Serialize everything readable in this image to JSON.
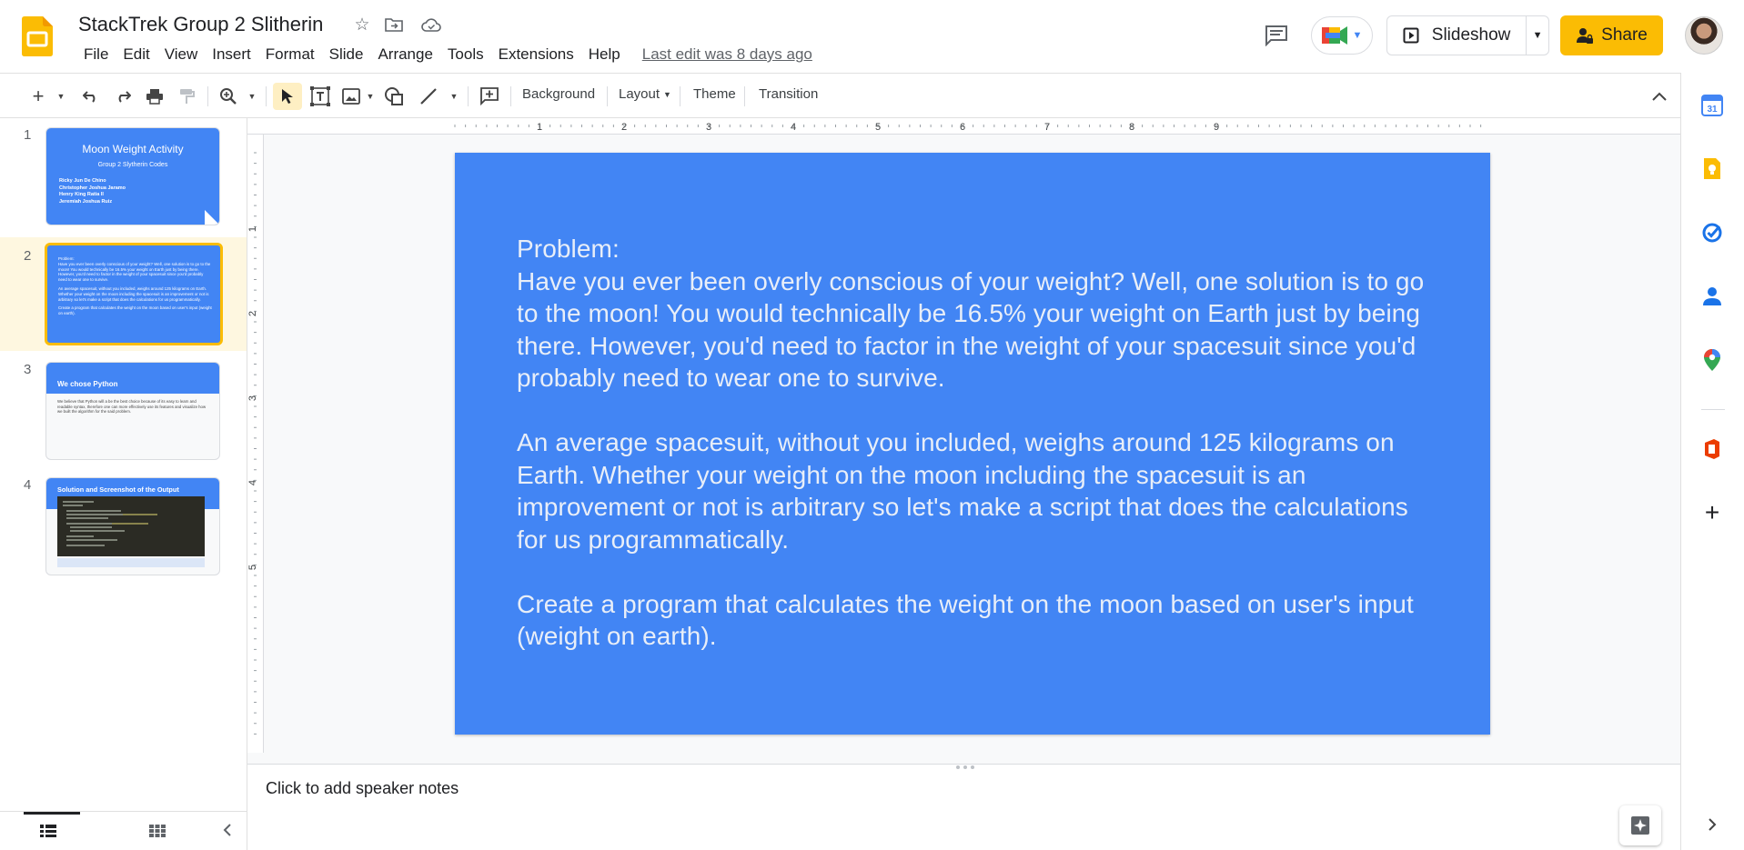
{
  "app": {
    "title": "StackTrek Group 2 Slitherin",
    "brand_color": "#fbbc04"
  },
  "menu": {
    "items": [
      "File",
      "Edit",
      "View",
      "Insert",
      "Format",
      "Slide",
      "Arrange",
      "Tools",
      "Extensions",
      "Help"
    ],
    "last_edit": "Last edit was 8 days ago"
  },
  "header": {
    "slideshow_label": "Slideshow",
    "share_label": "Share"
  },
  "toolbar": {
    "background_label": "Background",
    "layout_label": "Layout",
    "theme_label": "Theme",
    "transition_label": "Transition"
  },
  "filmstrip": {
    "selected": 2,
    "slides": [
      {
        "number": "1",
        "title": "Moon Weight Activity",
        "subtitle": "Group 2 Slytherin Codes",
        "names": [
          "Ricky Jun De Chino",
          "Christopher Joshua Jaramo",
          "Henry King Ratia II",
          "Jeremiah Joshua Ruiz"
        ]
      },
      {
        "number": "2",
        "lines": [
          "Problem:",
          "Have you ever been overly conscious of your weight? Well, one solution is to go to the moon! You would technically be 16.5% your weight on Earth just by being there. However, you'd need to factor in the weight of your spacesuit since you'd probably need to wear one to survive.",
          "An average spacesuit, without you included, weighs around 125 kilograms on Earth. Whether your weight on the moon including the spacesuit is an improvement or not is arbitrary so let's make a script that does the calculations for us programmatically.",
          "Create a program that calculates the weight on the moon based on user's input (weight on earth)."
        ]
      },
      {
        "number": "3",
        "title": "We chose Python",
        "body": "We believe that Python will a be the best choice because of its easy to learn and readable syntax, therefore one can more effectively use its features and visualize how we built the algorithm for the said problem."
      },
      {
        "number": "4",
        "title": "Solution and Screenshot of the Output"
      }
    ]
  },
  "slide": {
    "background": "#4285f4",
    "paragraphs": [
      "Problem:\nHave you ever been overly conscious of your weight? Well, one solution is to go to the moon! You would technically be 16.5% your weight on Earth just by being there. However, you'd need to factor in the weight of your spacesuit since you'd probably need to wear one to survive.",
      "An average spacesuit, without you included, weighs around 125 kilograms on Earth. Whether your weight on the moon including the spacesuit is an improvement or not is arbitrary so let's make a script that does the calculations for us programmatically.",
      "Create a program that calculates the weight on the moon based on user's input (weight on earth)."
    ]
  },
  "rulers": {
    "horizontal_ticks": [
      "1",
      "2",
      "3",
      "4",
      "5",
      "6",
      "7",
      "8",
      "9"
    ],
    "vertical_ticks": [
      "1",
      "2",
      "3",
      "4",
      "5"
    ]
  },
  "notes": {
    "placeholder": "Click to add speaker notes"
  },
  "icons": {
    "side_panel": [
      "calendar-icon",
      "keep-icon",
      "tasks-icon",
      "contacts-icon",
      "maps-icon",
      "office-icon",
      "add-icon",
      "chevron-right-icon"
    ]
  }
}
